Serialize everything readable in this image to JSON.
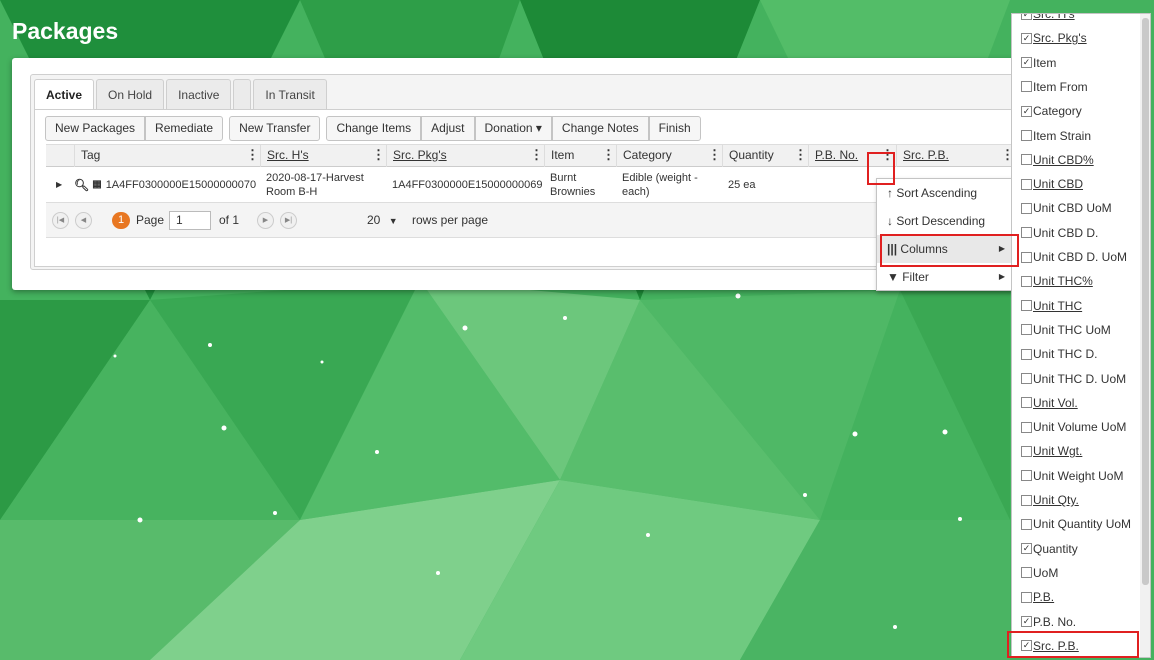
{
  "page": {
    "title": "Packages"
  },
  "tabs": [
    {
      "label": "Active",
      "active": true
    },
    {
      "label": "On Hold"
    },
    {
      "label": "Inactive"
    },
    {
      "label": ""
    },
    {
      "label": "In Transit"
    }
  ],
  "toolbar": {
    "new_packages": "New Packages",
    "remediate": "Remediate",
    "new_transfer": "New Transfer",
    "change_items": "Change Items",
    "adjust": "Adjust",
    "donation": "Donation ▾",
    "change_notes": "Change Notes",
    "finish": "Finish"
  },
  "columns": {
    "tag": "Tag",
    "src_hs": "Src. H's",
    "src_pkgs": "Src. Pkg's",
    "item": "Item",
    "category": "Category",
    "quantity": "Quantity",
    "pb_no": "P.B. No.",
    "src_pb": "Src. P.B."
  },
  "row": {
    "tag": "1A4FF0300000E15000000070",
    "src_hs": "2020-08-17-Harvest Room B-H",
    "src_pkgs": "1A4FF0300000E15000000069",
    "item": "Burnt Brownies",
    "category": "Edible (weight - each)",
    "quantity": "25 ea",
    "pb_no": "",
    "src_pb": ""
  },
  "pager": {
    "current_page": "1",
    "page_label": "Page",
    "page_input": "1",
    "of_label": "of 1",
    "rows_per_page_value": "20",
    "rows_per_page_label": "rows per page"
  },
  "column_menu": {
    "sort_ascending": "Sort Ascending",
    "sort_descending": "Sort Descending",
    "columns": "Columns",
    "filter": "Filter"
  },
  "column_chooser": [
    {
      "label": "Src. H's",
      "checked": true
    },
    {
      "label": "Src. Pkg's",
      "checked": true
    },
    {
      "label": "Item",
      "checked": true
    },
    {
      "label": "Item From",
      "checked": false
    },
    {
      "label": "Category",
      "checked": true
    },
    {
      "label": "Item Strain",
      "checked": false
    },
    {
      "label": "Unit CBD%",
      "checked": false
    },
    {
      "label": "Unit CBD",
      "checked": false
    },
    {
      "label": "Unit CBD UoM",
      "checked": false
    },
    {
      "label": "Unit CBD D.",
      "checked": false
    },
    {
      "label": "Unit CBD D. UoM",
      "checked": false
    },
    {
      "label": "Unit THC%",
      "checked": false
    },
    {
      "label": "Unit THC",
      "checked": false
    },
    {
      "label": "Unit THC UoM",
      "checked": false
    },
    {
      "label": "Unit THC D.",
      "checked": false
    },
    {
      "label": "Unit THC D. UoM",
      "checked": false
    },
    {
      "label": "Unit Vol.",
      "checked": false
    },
    {
      "label": "Unit Volume UoM",
      "checked": false
    },
    {
      "label": "Unit Wgt.",
      "checked": false
    },
    {
      "label": "Unit Weight UoM",
      "checked": false
    },
    {
      "label": "Unit Qty.",
      "checked": false
    },
    {
      "label": "Unit Quantity UoM",
      "checked": false
    },
    {
      "label": "Quantity",
      "checked": true
    },
    {
      "label": "UoM",
      "checked": false
    },
    {
      "label": "P.B.",
      "checked": false
    },
    {
      "label": "P.B. No.",
      "checked": true
    },
    {
      "label": "Src. P.B.",
      "checked": true
    }
  ],
  "colors": {
    "accent_orange": "#e87722",
    "highlight_red": "#e02020",
    "background_green": "#3fae5a"
  }
}
